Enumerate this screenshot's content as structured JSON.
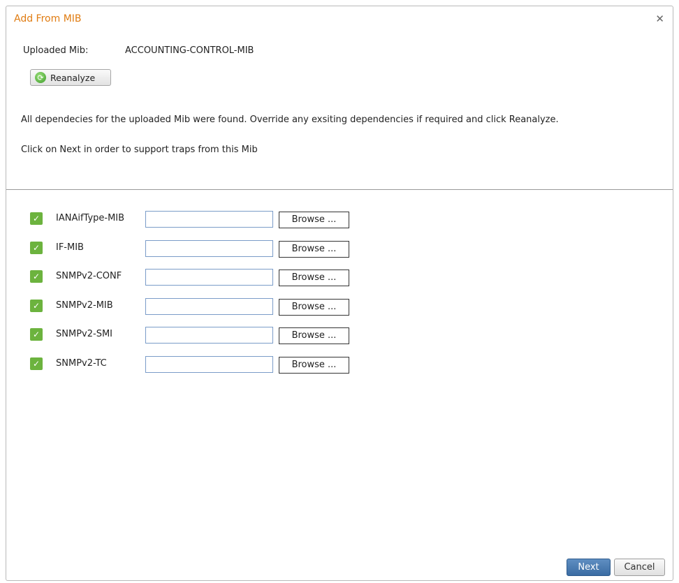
{
  "dialog": {
    "title": "Add From MIB",
    "close_icon": "close-icon",
    "uploaded_mib_label": "Uploaded Mib:",
    "uploaded_mib_value": "ACCOUNTING-CONTROL-MIB",
    "reanalyze_label": "Reanalyze",
    "reanalyze_icon": "refresh-icon",
    "message_dependencies": "All dependecies for the uploaded Mib were found. Override any exsiting dependencies if required and click Reanalyze.",
    "message_next": "Click on Next in order to support traps from this Mib"
  },
  "dependencies": [
    {
      "name": "IANAifType-MIB",
      "checked": true,
      "value": "",
      "browse_label": "Browse ..."
    },
    {
      "name": "IF-MIB",
      "checked": true,
      "value": "",
      "browse_label": "Browse ..."
    },
    {
      "name": "SNMPv2-CONF",
      "checked": true,
      "value": "",
      "browse_label": "Browse ..."
    },
    {
      "name": "SNMPv2-MIB",
      "checked": true,
      "value": "",
      "browse_label": "Browse ..."
    },
    {
      "name": "SNMPv2-SMI",
      "checked": true,
      "value": "",
      "browse_label": "Browse ..."
    },
    {
      "name": "SNMPv2-TC",
      "checked": true,
      "value": "",
      "browse_label": "Browse ..."
    }
  ],
  "footer": {
    "next_label": "Next",
    "cancel_label": "Cancel"
  },
  "colors": {
    "title": "#e07c12",
    "checkbox": "#6cb33e",
    "primary_button": "#3a6ca3"
  }
}
